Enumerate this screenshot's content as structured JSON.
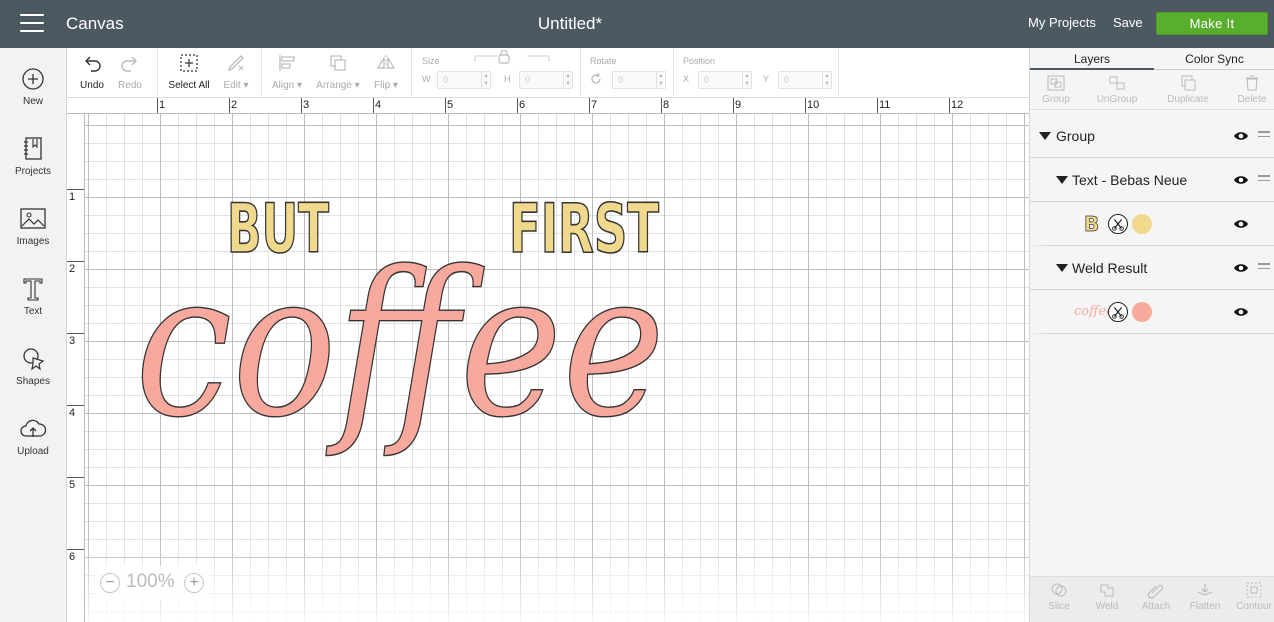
{
  "header": {
    "app_title": "Canvas",
    "doc_title": "Untitled*",
    "my_projects": "My Projects",
    "save": "Save",
    "make_it": "Make It",
    "accent_color": "#5aae2e",
    "bar_color": "#4d5961"
  },
  "sidebar": {
    "items": [
      {
        "label": "New",
        "icon": "plus-circle-icon"
      },
      {
        "label": "Projects",
        "icon": "notebook-icon"
      },
      {
        "label": "Images",
        "icon": "image-icon"
      },
      {
        "label": "Text",
        "icon": "text-t-icon"
      },
      {
        "label": "Shapes",
        "icon": "shapes-icon"
      },
      {
        "label": "Upload",
        "icon": "cloud-upload-icon"
      }
    ]
  },
  "toolbar": {
    "undo": "Undo",
    "redo": "Redo",
    "select_all": "Select All",
    "edit": "Edit",
    "align": "Align",
    "arrange": "Arrange",
    "flip": "Flip",
    "size_label": "Size",
    "w_label": "W",
    "h_label": "H",
    "w_value": "0",
    "h_value": "0",
    "rotate_label": "Rotate",
    "rotate_value": "0",
    "position_label": "Position",
    "x_label": "X",
    "y_label": "Y",
    "x_value": "0",
    "y_value": "0"
  },
  "ruler": {
    "horizontal": [
      "1",
      "2",
      "3",
      "4",
      "5",
      "6",
      "7",
      "8",
      "9",
      "10",
      "11",
      "12"
    ],
    "vertical": [
      "1",
      "2",
      "3",
      "4",
      "5",
      "6"
    ]
  },
  "canvas": {
    "design_text_1": "BUT",
    "design_text_2": "FIRST",
    "design_script": "coffee",
    "text_color": "#f0d98d",
    "script_color": "#f7a99e",
    "zoom": "100%"
  },
  "right_panel": {
    "tabs": [
      "Layers",
      "Color Sync"
    ],
    "tools": [
      "Group",
      "UnGroup",
      "Duplicate",
      "Delete"
    ],
    "layers": {
      "group": "Group",
      "text_layer": "Text - Bebas Neue",
      "text_thumb": "B",
      "weld_layer": "Weld Result",
      "weld_thumb": "coffee",
      "text_swatch": "#f0d98d",
      "weld_swatch": "#f7a99e"
    },
    "bottom_tools": [
      "Slice",
      "Weld",
      "Attach",
      "Flatten",
      "Contour"
    ]
  }
}
